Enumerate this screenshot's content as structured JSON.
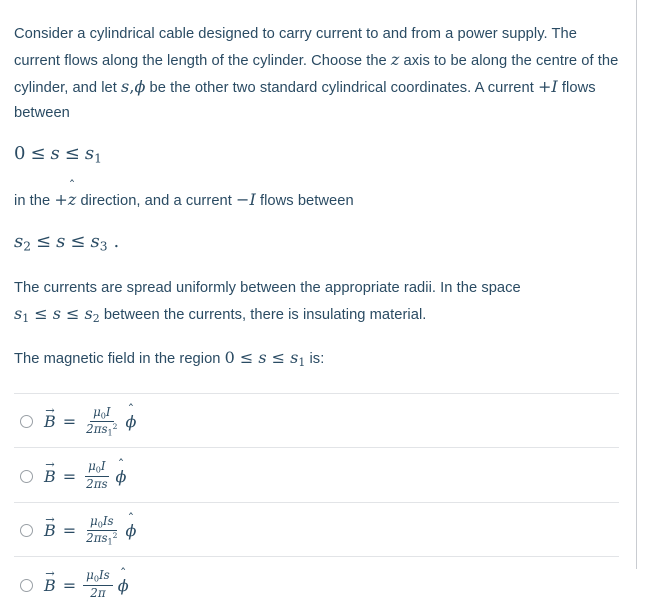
{
  "question": {
    "paragraph_1": "Consider a cylindrical cable designed to carry current to and from a power supply. The current flows along the length of the cylinder. Choose the ",
    "p1_axis_symbol": "z",
    "paragraph_1_cont": " axis to be along the centre of the cylinder, and let ",
    "p1_coord_s": "s",
    "p1_coord_comma": ",",
    "p1_coord_phi": "ϕ",
    "paragraph_1_end": " be the other two standard cylindrical coordinates. A current ",
    "p1_current_plus": "+I",
    "paragraph_1_tail": " flows between",
    "equation_1": {
      "lower": "0",
      "rel1": "≤",
      "var": "s",
      "rel2": "≤",
      "upper_base": "s",
      "upper_sub": "1"
    },
    "paragraph_2_pre": "in the ",
    "p2_direction_sign": "+",
    "p2_direction_var": "z",
    "p2_direction_hat": "ˆ",
    "paragraph_2_mid": " direction, and a current ",
    "p2_current_minus": "−I",
    "paragraph_2_end": " flows between",
    "equation_2": {
      "lower_base": "s",
      "lower_sub": "2",
      "rel1": "≤",
      "var": "s",
      "rel2": "≤",
      "upper_base": "s",
      "upper_sub": "3",
      "period": "."
    },
    "paragraph_3_pre": "The currents are spread uniformly between the appropriate radii. In the space ",
    "equation_3": {
      "lower_base": "s",
      "lower_sub": "1",
      "rel1": "≤",
      "var": "s",
      "rel2": "≤",
      "upper_base": "s",
      "upper_sub": "2"
    },
    "paragraph_3_end": " between the currents, there is insulating material.",
    "paragraph_4_pre": "The magnetic field in the region ",
    "equation_4": {
      "lower": "0",
      "rel1": "≤",
      "var": "s",
      "rel2": "≤",
      "upper_base": "s",
      "upper_sub": "1"
    },
    "paragraph_4_end": " is:"
  },
  "symbols": {
    "B_base": "B",
    "vector_arrow": "→",
    "equals": "=",
    "mu": "μ",
    "mu_sub": "0",
    "current_I": "I",
    "radius_s": "s",
    "two_pi": "2π",
    "phi": "ϕ",
    "hat_accent": "ˆ"
  },
  "options": [
    {
      "id": "option-a",
      "selected": false,
      "numerator_mu": "μ",
      "numerator_mu_sub": "0",
      "numerator_rest": "I",
      "denominator_prefix": "2πs",
      "denominator_sub": "1",
      "denominator_sup": "2",
      "unit_vector": "ϕ",
      "latex": "\\vec{B} = \\frac{\\mu_0 I}{2\\pi s_1^2}\\hat{\\phi}"
    },
    {
      "id": "option-b",
      "selected": false,
      "numerator_mu": "μ",
      "numerator_mu_sub": "0",
      "numerator_rest": "I",
      "denominator_prefix": "2πs",
      "denominator_sub": "",
      "denominator_sup": "",
      "unit_vector": "ϕ",
      "latex": "\\vec{B} = \\frac{\\mu_0 I}{2\\pi s}\\hat{\\phi}"
    },
    {
      "id": "option-c",
      "selected": false,
      "numerator_mu": "μ",
      "numerator_mu_sub": "0",
      "numerator_rest": "Is",
      "denominator_prefix": "2πs",
      "denominator_sub": "1",
      "denominator_sup": "2",
      "unit_vector": "ϕ",
      "latex": "\\vec{B} = \\frac{\\mu_0 I s}{2\\pi s_1^2}\\hat{\\phi}"
    },
    {
      "id": "option-d",
      "selected": false,
      "numerator_mu": "μ",
      "numerator_mu_sub": "0",
      "numerator_rest": "Is",
      "denominator_prefix": "2π",
      "denominator_sub": "",
      "denominator_sup": "",
      "unit_vector": "ϕ",
      "latex": "\\vec{B} = \\frac{\\mu_0 I s}{2\\pi}\\hat{\\phi}"
    }
  ],
  "colors": {
    "text": "#2a4b63",
    "divider": "#e2e4e7",
    "radio_border": "#9aa0a6",
    "page_border": "#c9ccd1",
    "background": "#ffffff"
  }
}
